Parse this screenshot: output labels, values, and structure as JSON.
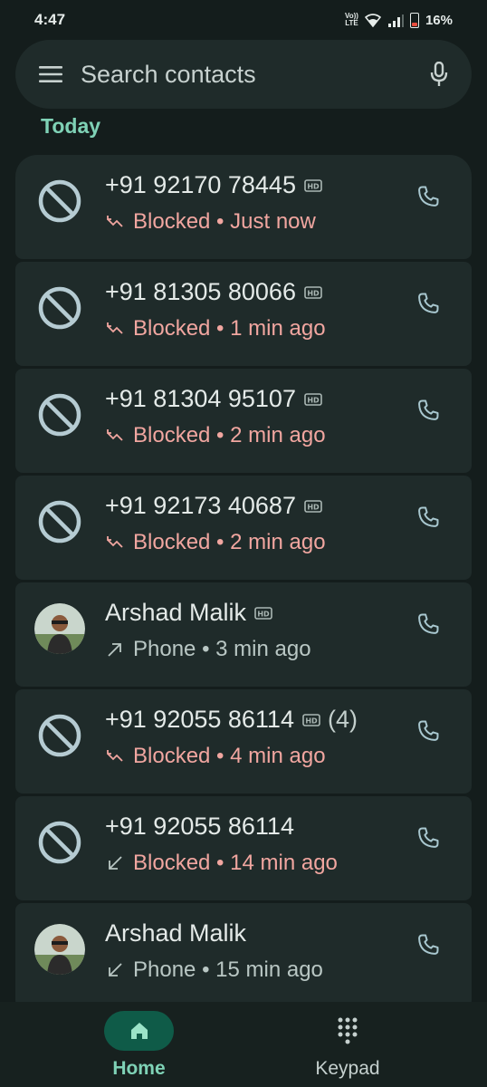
{
  "status_bar": {
    "time": "4:47",
    "volte_top": "Vo))",
    "volte_bottom": "LTE",
    "battery": "16%"
  },
  "search": {
    "placeholder": "Search contacts",
    "menu_icon": "menu-icon",
    "mic_icon": "mic-icon"
  },
  "section": {
    "today": "Today"
  },
  "calls": [
    {
      "name": "+91 92170 78445",
      "hd": true,
      "count": "",
      "status": "Blocked",
      "time": "Just now",
      "direction": "missed",
      "kind": "blocked"
    },
    {
      "name": "+91 81305 80066",
      "hd": true,
      "count": "",
      "status": "Blocked",
      "time": "1 min ago",
      "direction": "missed",
      "kind": "blocked"
    },
    {
      "name": "+91 81304 95107",
      "hd": true,
      "count": "",
      "status": "Blocked",
      "time": "2 min ago",
      "direction": "missed",
      "kind": "blocked"
    },
    {
      "name": "+91 92173 40687",
      "hd": true,
      "count": "",
      "status": "Blocked",
      "time": "2 min ago",
      "direction": "missed",
      "kind": "blocked"
    },
    {
      "name": "Arshad Malik",
      "hd": true,
      "count": "",
      "status": "Phone",
      "time": "3 min ago",
      "direction": "outgoing",
      "kind": "contact"
    },
    {
      "name": "+91 92055 86114",
      "hd": true,
      "count": "(4)",
      "status": "Blocked",
      "time": "4 min ago",
      "direction": "missed",
      "kind": "blocked"
    },
    {
      "name": "+91 92055 86114",
      "hd": false,
      "count": "",
      "status": "Blocked",
      "time": "14 min ago",
      "direction": "incoming",
      "kind": "blocked"
    },
    {
      "name": "Arshad Malik",
      "hd": false,
      "count": "",
      "status": "Phone",
      "time": "15 min ago",
      "direction": "incoming",
      "kind": "contact"
    }
  ],
  "separator": " • ",
  "bottom_nav": {
    "home_label": "Home",
    "keypad_label": "Keypad"
  },
  "colors": {
    "background": "#141d1c",
    "card": "#1f2b2a",
    "accent": "#7fd2b6",
    "blocked": "#f1a6a0",
    "icon": "#a9c8d0"
  }
}
